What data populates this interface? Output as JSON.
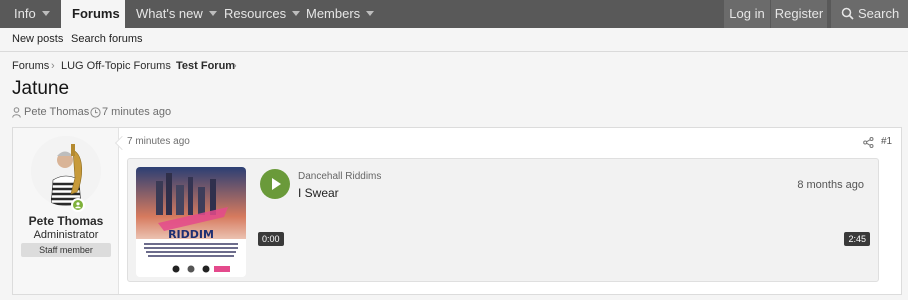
{
  "nav": {
    "items": [
      {
        "label": "Info"
      },
      {
        "label": "Forums"
      },
      {
        "label": "What's new"
      },
      {
        "label": "Resources"
      },
      {
        "label": "Members"
      }
    ],
    "login": "Log in",
    "register": "Register",
    "search": "Search"
  },
  "subnav": {
    "new_posts": "New posts",
    "search_forums": "Search forums"
  },
  "breadcrumb": [
    "Forums",
    "LUG Off-Topic Forums",
    "Test Forum"
  ],
  "thread": {
    "title": "Jatune",
    "author": "Pete Thomas",
    "separator": "·",
    "time": "7 minutes ago"
  },
  "post": {
    "time": "7 minutes ago",
    "number": "#1",
    "user": {
      "name": "Pete Thomas",
      "title": "Administrator",
      "badge": "Staff member"
    },
    "embed": {
      "artist": "Dancehall Riddims",
      "track": "I Swear",
      "age": "8 months ago",
      "current_time": "0:00",
      "duration": "2:45",
      "artwork_text": "RIDDIM"
    }
  }
}
